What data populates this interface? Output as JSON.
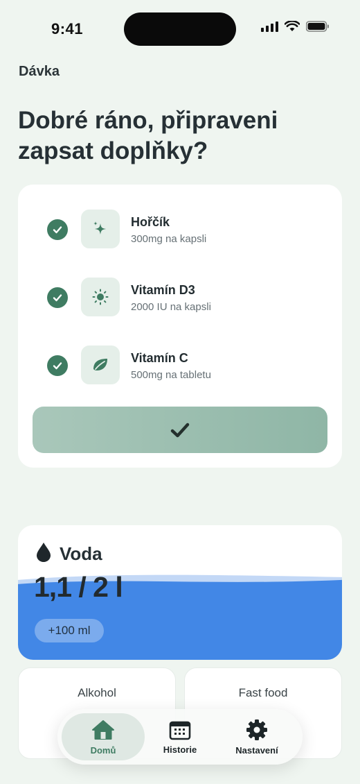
{
  "status_bar": {
    "time": "9:41"
  },
  "app": {
    "name": "Dávka"
  },
  "greeting": "Dobré ráno, připraveni zapsat doplňky?",
  "supplements": [
    {
      "name": "Hořčík",
      "dose": "300mg na kapsli",
      "icon": "sparkle-icon",
      "checked": true
    },
    {
      "name": "Vitamín D3",
      "dose": "2000 IU na kapsli",
      "icon": "sun-icon",
      "checked": true
    },
    {
      "name": "Vitamín C",
      "dose": "500mg na tabletu",
      "icon": "leaf-icon",
      "checked": true
    }
  ],
  "confirm_icon": "checkmark-icon",
  "water": {
    "title": "Voda",
    "amount": "1,1 / 2 l",
    "add_button": "+100 ml",
    "consumed_l": 1.1,
    "goal_l": 2
  },
  "trackers": [
    {
      "label": "Alkohol"
    },
    {
      "label": "Fast food"
    }
  ],
  "nav": [
    {
      "label": "Domů",
      "icon": "home-icon",
      "active": true
    },
    {
      "label": "Historie",
      "icon": "calendar-icon",
      "active": false
    },
    {
      "label": "Nastavení",
      "icon": "gear-icon",
      "active": false
    }
  ],
  "colors": {
    "accent": "#3f7c62",
    "water": "#4287e6",
    "background": "#eff5f0"
  }
}
